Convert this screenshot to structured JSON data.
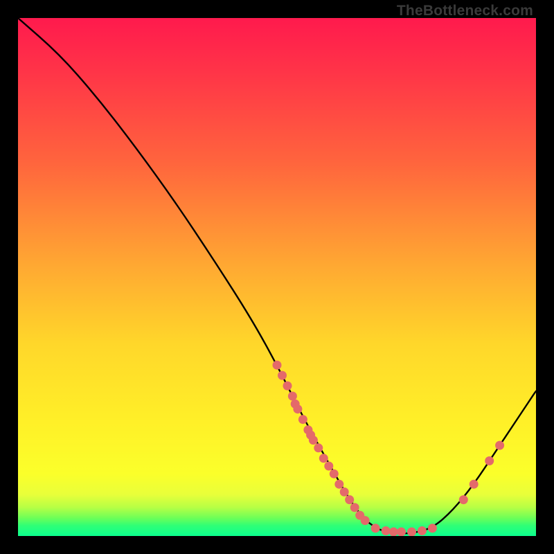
{
  "watermark_text": "TheBottleneck.com",
  "chart_data": {
    "type": "line",
    "title": "",
    "xlabel": "",
    "ylabel": "",
    "x_range": [
      0,
      100
    ],
    "y_range": [
      0,
      100
    ],
    "curve": [
      {
        "x": 0,
        "y": 100
      },
      {
        "x": 8,
        "y": 93
      },
      {
        "x": 15,
        "y": 85
      },
      {
        "x": 22,
        "y": 76
      },
      {
        "x": 30,
        "y": 65
      },
      {
        "x": 38,
        "y": 53
      },
      {
        "x": 45,
        "y": 42
      },
      {
        "x": 50,
        "y": 33
      },
      {
        "x": 55,
        "y": 23
      },
      {
        "x": 60,
        "y": 14
      },
      {
        "x": 64,
        "y": 7
      },
      {
        "x": 67,
        "y": 3
      },
      {
        "x": 70,
        "y": 1
      },
      {
        "x": 73,
        "y": 0.5
      },
      {
        "x": 76,
        "y": 0.5
      },
      {
        "x": 80,
        "y": 1.5
      },
      {
        "x": 84,
        "y": 5
      },
      {
        "x": 88,
        "y": 10
      },
      {
        "x": 92,
        "y": 16
      },
      {
        "x": 96,
        "y": 22
      },
      {
        "x": 100,
        "y": 28
      }
    ],
    "points": [
      {
        "x": 50,
        "y": 33
      },
      {
        "x": 51,
        "y": 31
      },
      {
        "x": 52,
        "y": 29
      },
      {
        "x": 53,
        "y": 27
      },
      {
        "x": 53.5,
        "y": 25.5
      },
      {
        "x": 54,
        "y": 24.5
      },
      {
        "x": 55,
        "y": 22.5
      },
      {
        "x": 56,
        "y": 20.5
      },
      {
        "x": 56.5,
        "y": 19.5
      },
      {
        "x": 57,
        "y": 18.5
      },
      {
        "x": 58,
        "y": 17
      },
      {
        "x": 59,
        "y": 15
      },
      {
        "x": 60,
        "y": 13.5
      },
      {
        "x": 61,
        "y": 12
      },
      {
        "x": 62,
        "y": 10
      },
      {
        "x": 63,
        "y": 8.5
      },
      {
        "x": 64,
        "y": 7
      },
      {
        "x": 65,
        "y": 5.5
      },
      {
        "x": 66,
        "y": 4
      },
      {
        "x": 67,
        "y": 3
      },
      {
        "x": 69,
        "y": 1.5
      },
      {
        "x": 71,
        "y": 1
      },
      {
        "x": 72.5,
        "y": 0.8
      },
      {
        "x": 74,
        "y": 0.8
      },
      {
        "x": 76,
        "y": 0.8
      },
      {
        "x": 78,
        "y": 1
      },
      {
        "x": 80,
        "y": 1.5
      },
      {
        "x": 86,
        "y": 7
      },
      {
        "x": 88,
        "y": 10
      },
      {
        "x": 91,
        "y": 14.5
      },
      {
        "x": 93,
        "y": 17.5
      }
    ],
    "point_color": "#e46a6a",
    "curve_color": "#000000"
  }
}
